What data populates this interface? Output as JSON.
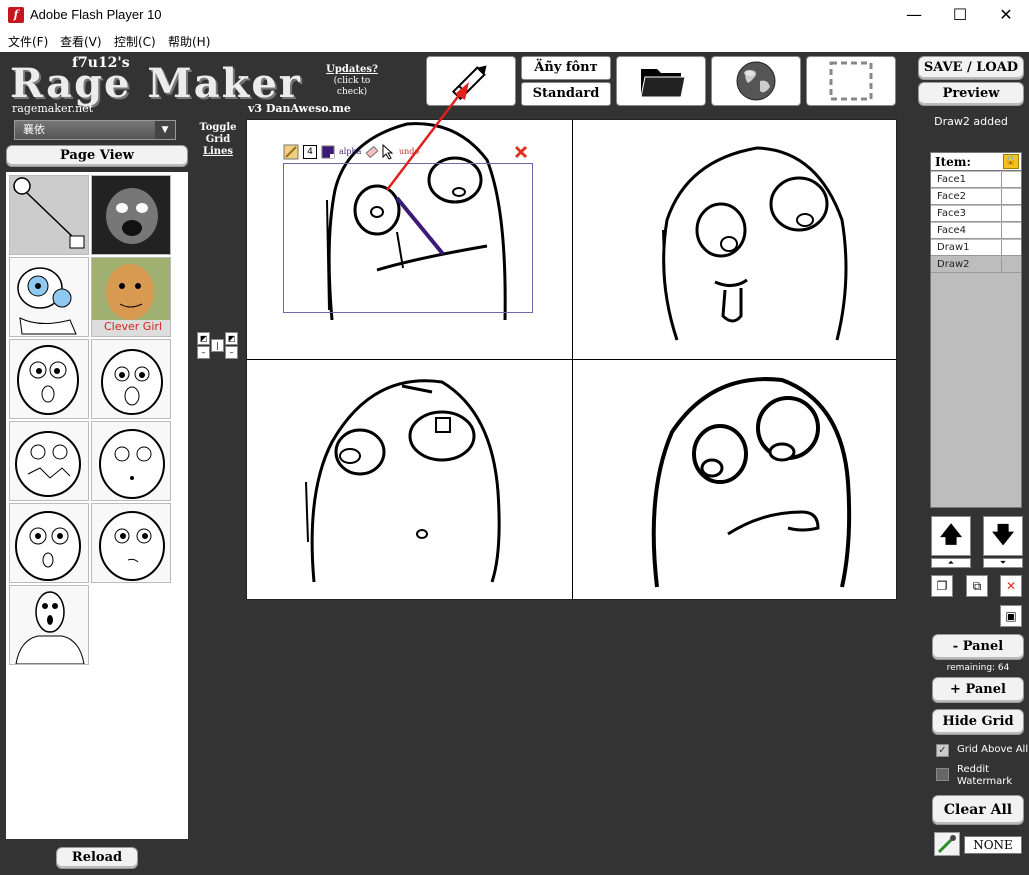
{
  "window": {
    "title": "Adobe Flash Player 10",
    "minimize": "—",
    "maximize": "☐",
    "close": "✕"
  },
  "menu": [
    "文件(F)",
    "查看(V)",
    "控制(C)",
    "帮助(H)"
  ],
  "header": {
    "logo_author": "f7u12's",
    "logo_title": "Rage Maker",
    "logo_site": "ragemaker.net",
    "updates_title": "Updates?",
    "updates_sub": "(click to check)",
    "version": "v3  DanAweso.me"
  },
  "toolbar": {
    "font_any": "Äñy fônт",
    "font_standard": "Standard",
    "save_load": "SAVE / LOAD",
    "preview": "Preview"
  },
  "status": "Draw2 added",
  "library": {
    "dropdown_value": "襄依",
    "page_view": "Page View",
    "reload": "Reload",
    "clever_girl": "Clever Girl"
  },
  "toggle_grid": {
    "line1": "Toggle",
    "line2": "Grid",
    "line3": "Lines"
  },
  "drawbar": {
    "size": "4",
    "alpha": "alpha",
    "undo": "undo"
  },
  "layers": {
    "header": "Item:",
    "items": [
      "Face1",
      "Face2",
      "Face3",
      "Face4",
      "Draw1",
      "Draw2"
    ],
    "selected": "Draw2"
  },
  "controls": {
    "minus_panel": "- Panel",
    "remaining": "remaining: 64",
    "plus_panel": "+ Panel",
    "hide_grid": "Hide Grid",
    "grid_above_all": "Grid Above All",
    "reddit_watermark": "Reddit Watermark",
    "clear_all": "Clear All",
    "color_value": "NONE"
  },
  "colors": {
    "app_bg": "#333333",
    "draw_line": "#3b1a78",
    "arrow": "#e0201c"
  }
}
